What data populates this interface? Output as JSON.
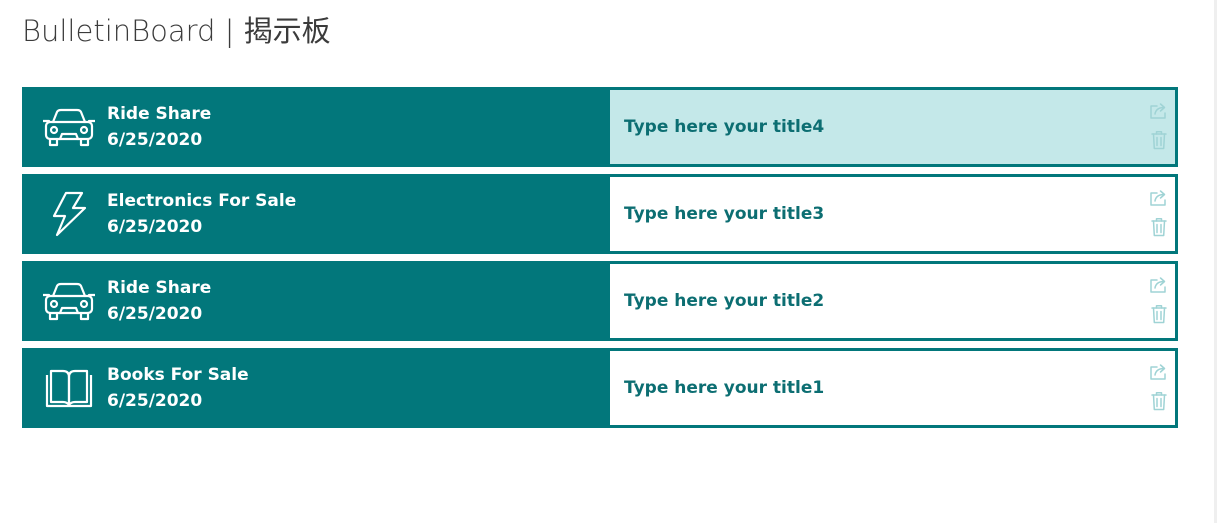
{
  "app": {
    "title": "BulletinBoard | 揭示板"
  },
  "colors": {
    "card_bg": "#02777b",
    "active_bg": "#c4e8e9",
    "title_text": "#0c6e72",
    "action_icon": "#9fd3d5"
  },
  "posts": [
    {
      "category": "Ride Share",
      "date": "6/25/2020",
      "icon": "car-icon",
      "title": "Type here your title4",
      "active": true
    },
    {
      "category": "Electronics For Sale",
      "date": "6/25/2020",
      "icon": "lightning-icon",
      "title": "Type here your title3",
      "active": false
    },
    {
      "category": "Ride Share",
      "date": "6/25/2020",
      "icon": "car-icon",
      "title": "Type here your title2",
      "active": false
    },
    {
      "category": "Books For Sale",
      "date": "6/25/2020",
      "icon": "book-icon",
      "title": "Type here your title1",
      "active": false
    }
  ],
  "actions": {
    "share_icon": "share-icon",
    "delete_icon": "trash-icon"
  }
}
